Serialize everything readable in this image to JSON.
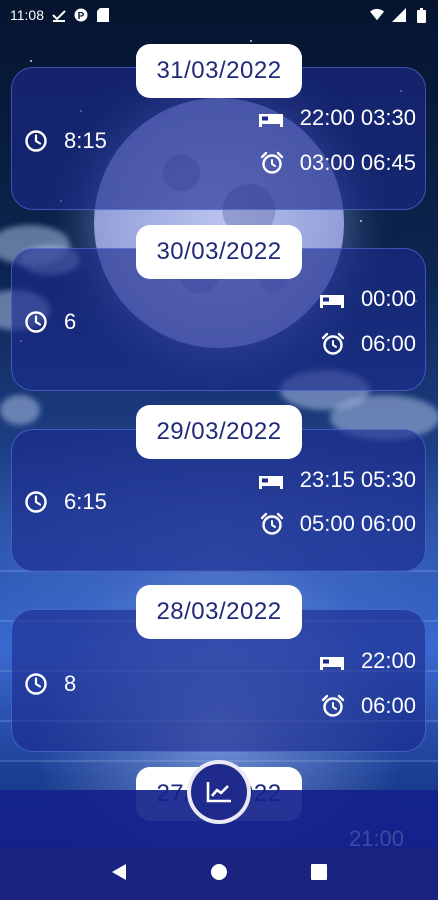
{
  "status_bar": {
    "time": "11:08",
    "left_icons": [
      "check-download-icon",
      "p-badge-icon",
      "sd-card-icon"
    ],
    "right_icons": [
      "wifi-icon",
      "signal-icon",
      "battery-icon"
    ]
  },
  "entries": [
    {
      "date": "31/03/2022",
      "duration": "8:15",
      "sleep": "22:00 03:30",
      "alarm": "03:00 06:45"
    },
    {
      "date": "30/03/2022",
      "duration": "6",
      "sleep": "00:00",
      "alarm": "06:00"
    },
    {
      "date": "29/03/2022",
      "duration": "6:15",
      "sleep": "23:15 05:30",
      "alarm": "05:00 06:00"
    },
    {
      "date": "28/03/2022",
      "duration": "8",
      "sleep": "22:00",
      "alarm": "06:00"
    },
    {
      "date": "27/03/2022",
      "sleep": "21:00"
    }
  ],
  "fab": {
    "icon": "chart-icon"
  },
  "nav": {
    "back_icon": "back-icon",
    "home_icon": "home-icon",
    "recents_icon": "recents-icon"
  },
  "colors": {
    "card_bg": "#1c2a8c",
    "pill_text": "#1f2a7a",
    "bottom_bar": "#14228c",
    "nav_bar": "#1b2380"
  }
}
